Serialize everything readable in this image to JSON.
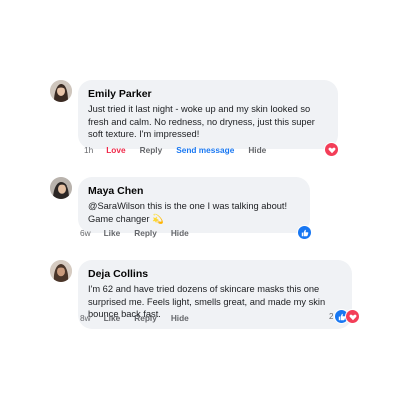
{
  "comments": [
    {
      "author": "Emily Parker",
      "text": "Just tried it last night - woke up and my skin looked so fresh and calm. No redness, no dryness, just this super soft texture. I'm impressed!",
      "time": "1h",
      "actions": [
        "Love",
        "Reply",
        "Send message",
        "Hide"
      ],
      "reactions": [
        "heart-icon"
      ]
    },
    {
      "author": "Maya Chen",
      "text": "@SaraWilson this is the one I was talking about! Game changer 💫",
      "time": "6w",
      "actions": [
        "Like",
        "Reply",
        "Hide"
      ],
      "reactions": [
        "like-icon"
      ]
    },
    {
      "author": "Deja Collins",
      "text": "I'm 62 and have tried dozens of skincare masks this one surprised me. Feels light, smells great, and made my skin bounce back fast.",
      "time": "8w",
      "actions": [
        "Like",
        "Reply",
        "Hide"
      ],
      "reaction_count": "2",
      "reactions": [
        "like-icon",
        "heart-icon"
      ]
    }
  ],
  "colors": {
    "bubble": "#f0f2f5",
    "love": "#f02849",
    "link": "#1877f2",
    "heart": "#f33e58",
    "like": "#1877f2"
  }
}
